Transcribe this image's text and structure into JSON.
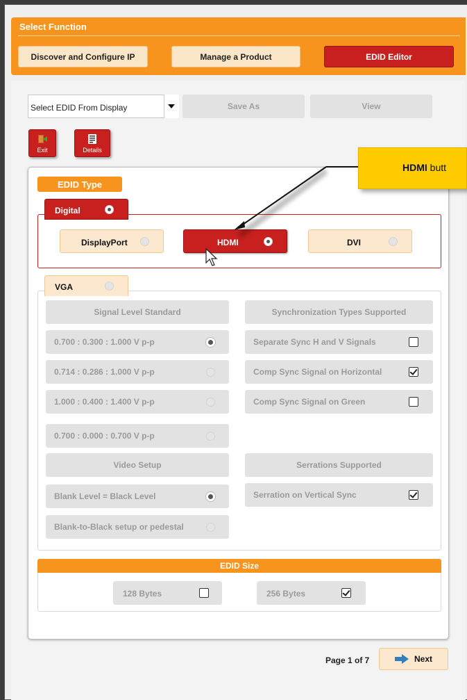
{
  "header": {
    "title": "Select Function",
    "tabs": [
      {
        "label": "Discover and Configure IP",
        "active": false
      },
      {
        "label": "Manage a Product",
        "active": false
      },
      {
        "label": "EDID Editor",
        "active": true
      }
    ]
  },
  "toolbar": {
    "select_value": "Select EDID From Display",
    "save_as_label": "Save As",
    "view_label": "View",
    "exit_label": "Exit",
    "details_label": "Details"
  },
  "edid_type": {
    "label": "EDID Type",
    "digital": {
      "label": "Digital",
      "selected": true,
      "options": [
        {
          "label": "DisplayPort",
          "selected": false
        },
        {
          "label": "HDMI",
          "selected": true
        },
        {
          "label": "DVI",
          "selected": false
        }
      ]
    },
    "vga": {
      "label": "VGA",
      "selected": false,
      "signal_level_header": "Signal Level Standard",
      "signal_levels": [
        {
          "label": "0.700 : 0.300 : 1.000 V p-p",
          "selected": true
        },
        {
          "label": "0.714 : 0.286 : 1.000 V p-p",
          "selected": false
        },
        {
          "label": "1.000 : 0.400 : 1.400 V p-p",
          "selected": false
        },
        {
          "label": "0.700 : 0.000 : 0.700 V p-p",
          "selected": false
        }
      ],
      "sync_header": "Synchronization Types Supported",
      "sync_types": [
        {
          "label": "Separate Sync H and V Signals",
          "checked": false
        },
        {
          "label": "Comp Sync Signal on Horizontal",
          "checked": true
        },
        {
          "label": "Comp Sync Signal on Green",
          "checked": false
        }
      ],
      "video_setup_header": "Video Setup",
      "video_setup": [
        {
          "label": "Blank Level = Black Level",
          "selected": true
        },
        {
          "label": "Blank-to-Black setup or pedestal",
          "selected": false
        }
      ],
      "serrations_header": "Serrations Supported",
      "serrations": [
        {
          "label": "Serration on Vertical Sync",
          "checked": true
        }
      ]
    }
  },
  "edid_size": {
    "label": "EDID Size",
    "options": [
      {
        "label": "128 Bytes",
        "checked": false
      },
      {
        "label": "256 Bytes",
        "checked": true
      }
    ]
  },
  "callout": {
    "bold": "HDMI",
    "text": " butt"
  },
  "pager": {
    "page_text": "Page 1 of 7",
    "next_label": "Next"
  },
  "colors": {
    "accent": "#f7941d",
    "active": "#c8201e",
    "callout": "#ffcc00"
  }
}
